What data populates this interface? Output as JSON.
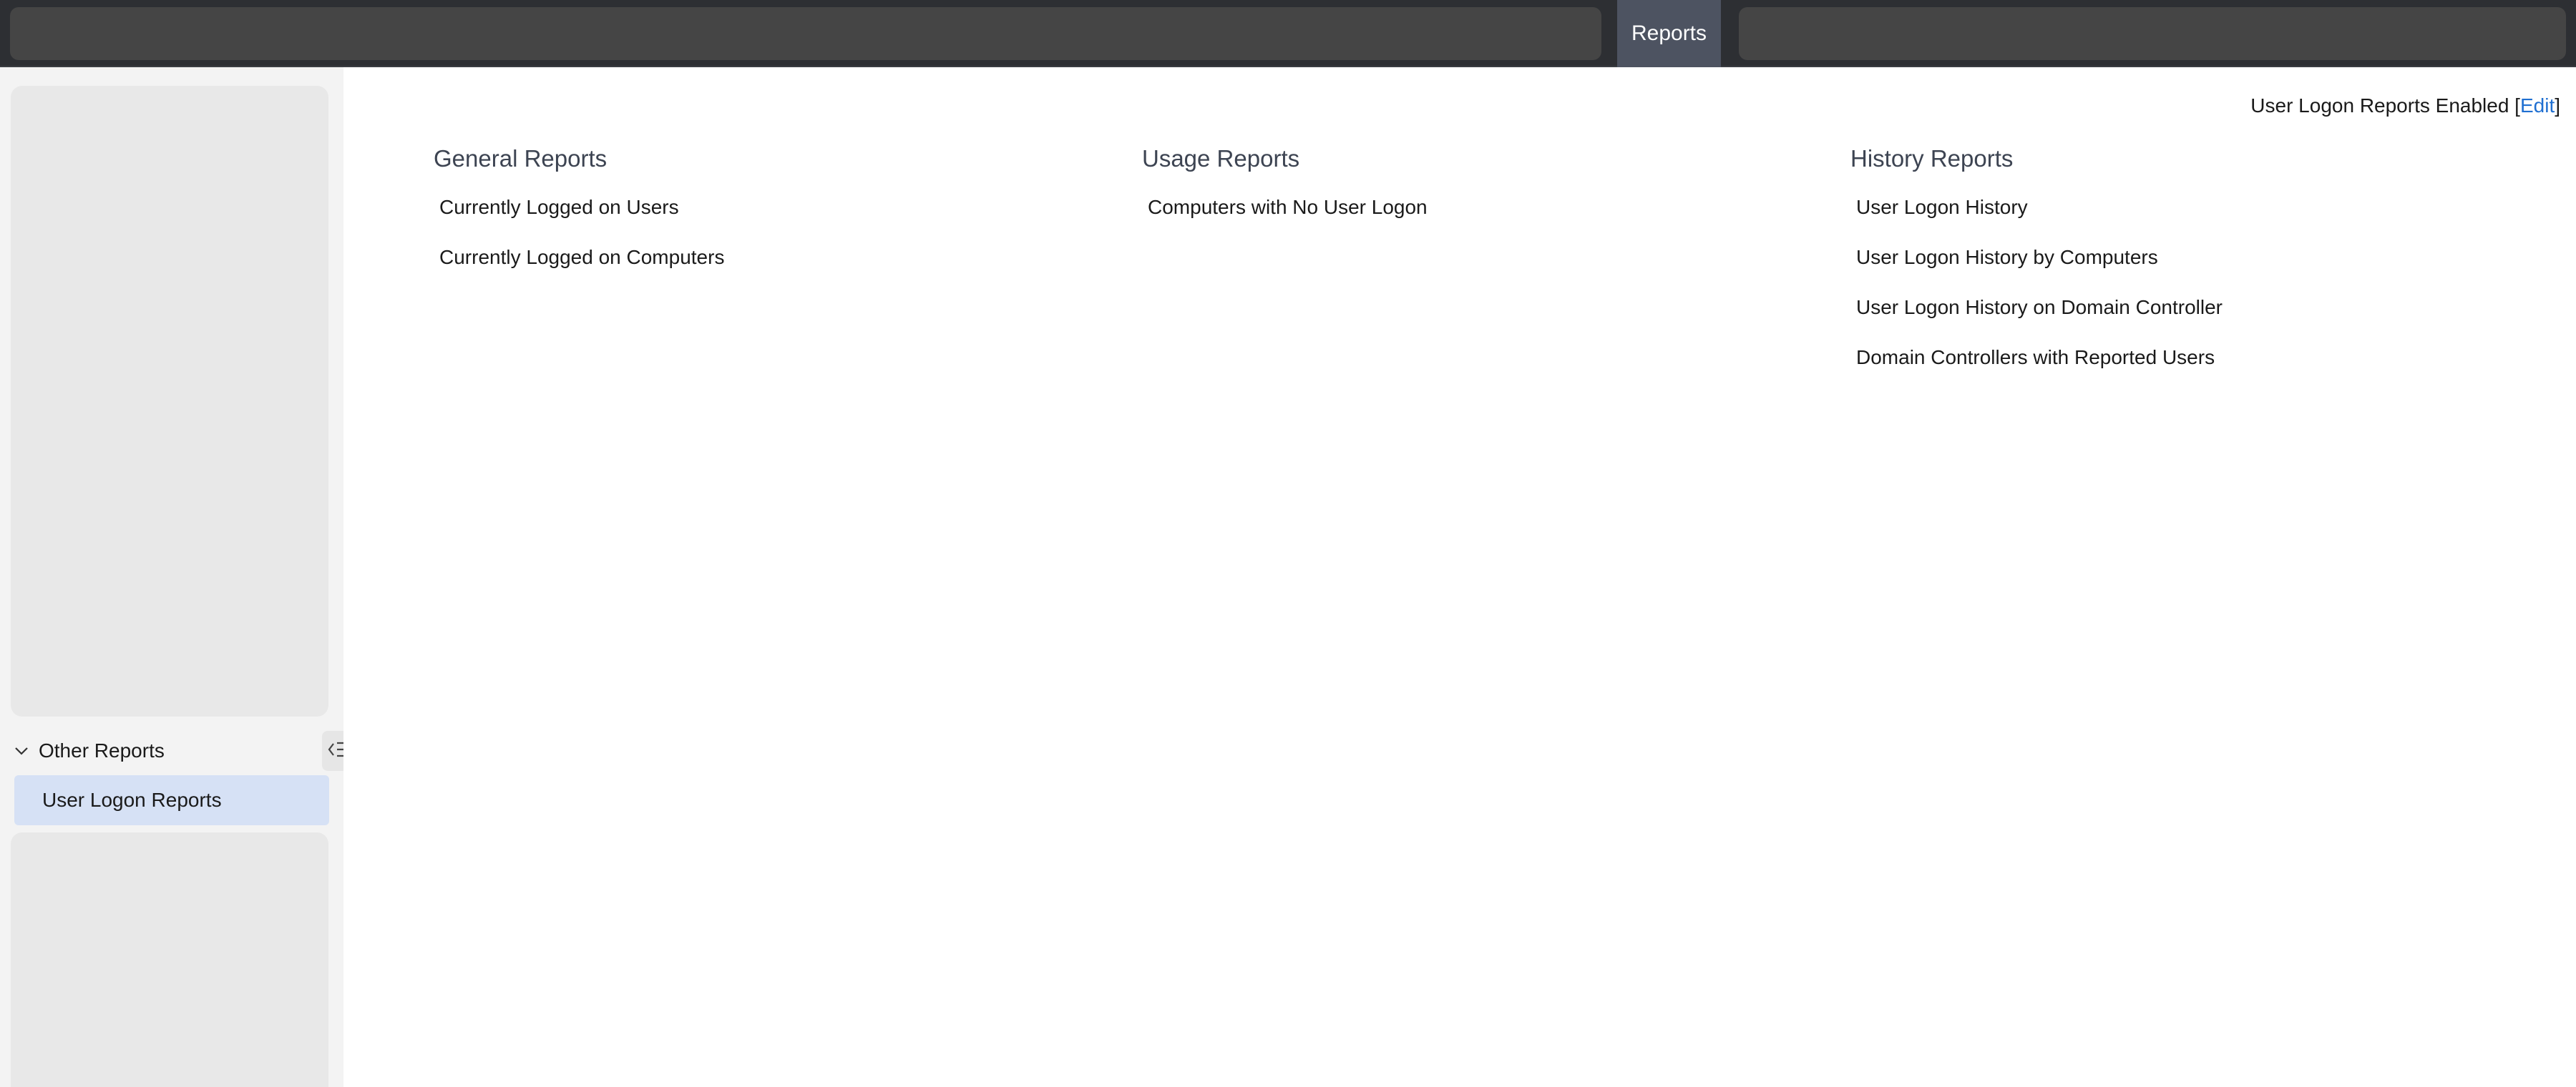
{
  "topbar": {
    "active_tab": "Reports"
  },
  "sidebar": {
    "section_label": "Other Reports",
    "items": [
      {
        "label": "User Logon Reports",
        "active": true
      }
    ]
  },
  "main": {
    "status_prefix": "User Logon Reports Enabled [",
    "edit_label": "Edit",
    "status_suffix": "]",
    "columns": [
      {
        "title": "General Reports",
        "links": [
          "Currently Logged on Users",
          "Currently Logged on Computers"
        ]
      },
      {
        "title": "Usage Reports",
        "links": [
          "Computers with No User Logon"
        ]
      },
      {
        "title": "History Reports",
        "links": [
          "User Logon History",
          "User Logon History by Computers",
          "User Logon History on Domain Controller",
          "Domain Controllers with Reported Users"
        ]
      }
    ]
  },
  "colors": {
    "topbar_bg": "#2d2f33",
    "active_tab_bg": "#4d5361",
    "sidebar_active_bg": "#d6e1f5",
    "link_blue": "#1f6fd1"
  },
  "icons": {
    "section_toggle": "chevron-down-icon",
    "collapse_sidebar": "collapse-sidebar-icon"
  }
}
